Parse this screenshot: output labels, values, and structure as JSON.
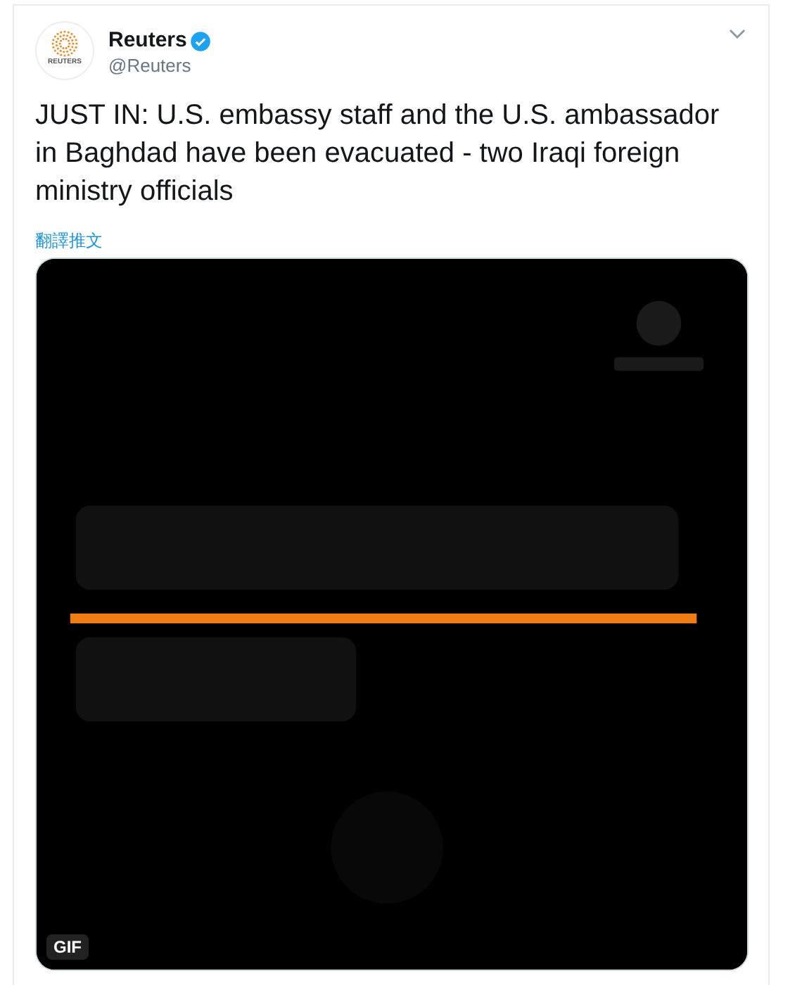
{
  "tweet": {
    "author": {
      "name": "Reuters",
      "verified": true,
      "handle": "@Reuters",
      "avatar_text": "REUTERS"
    },
    "text": "JUST IN: U.S. embassy staff and the U.S. ambassador in Baghdad have been evacuated - two Iraqi foreign ministry officials",
    "translate_link": "翻譯推文",
    "media": {
      "kind": "picture",
      "badge": "GIF"
    }
  }
}
